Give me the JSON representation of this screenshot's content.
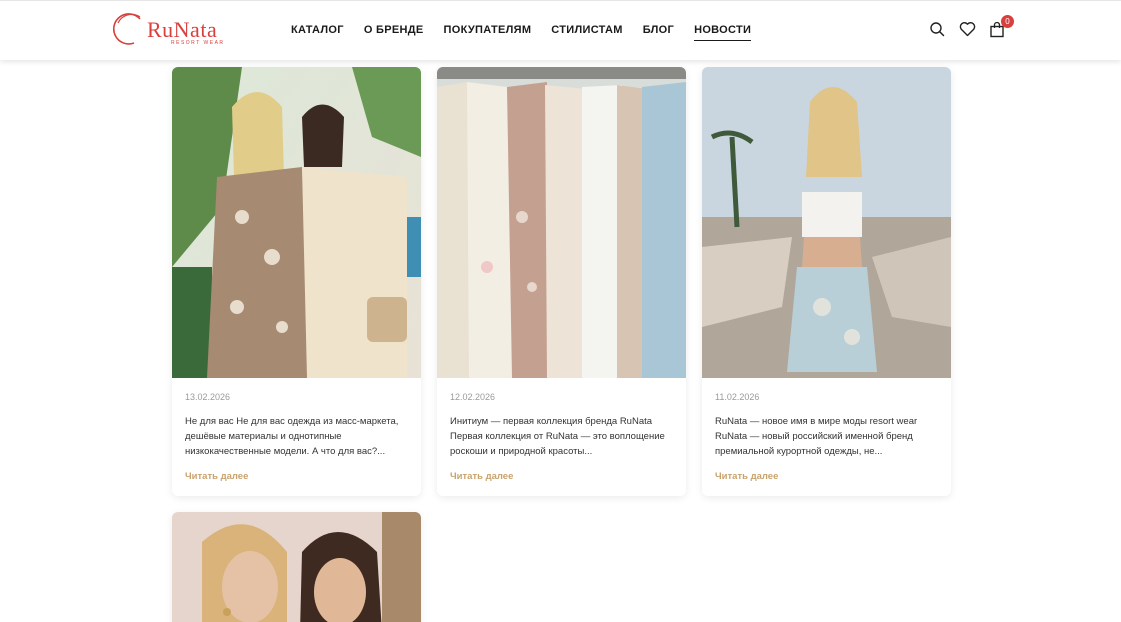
{
  "brand": {
    "name": "RuNata",
    "tagline": "RESORT WEAR",
    "accent": "#d8403f",
    "link_color": "#c9a36e"
  },
  "nav": {
    "items": [
      {
        "label": "КАТАЛОГ"
      },
      {
        "label": "О БРЕНДЕ"
      },
      {
        "label": "ПОКУПАТЕЛЯМ"
      },
      {
        "label": "СТИЛИСТАМ"
      },
      {
        "label": "БЛОГ"
      },
      {
        "label": "НОВОСТИ",
        "active": true
      }
    ]
  },
  "header_icons": {
    "search": "search-icon",
    "wishlist": "heart-icon",
    "cart": "cart-icon",
    "cart_count": "0"
  },
  "news": [
    {
      "date": "13.02.2026",
      "excerpt": "Не для вас Не для вас одежда из масс-маркета, дешёвые материалы и однотипные низкокачественные модели. А что для вас?...",
      "link": "Читать далее",
      "image": "two-women-in-resort-wear-photo"
    },
    {
      "date": "12.02.2026",
      "excerpt": "Инитиум — первая коллекция бренда RuNata Первая коллекция от RuNata — это воплощение роскоши и природной красоты...",
      "link": "Читать далее",
      "image": "clothes-on-rack-photo"
    },
    {
      "date": "11.02.2026",
      "excerpt": "RuNata — новое имя в мире моды resort wear RuNata — новый российский именной бренд премиальной курортной одежды, не...",
      "link": "Читать далее",
      "image": "woman-on-beach-photo"
    },
    {
      "image": "two-women-portrait-photo"
    }
  ]
}
